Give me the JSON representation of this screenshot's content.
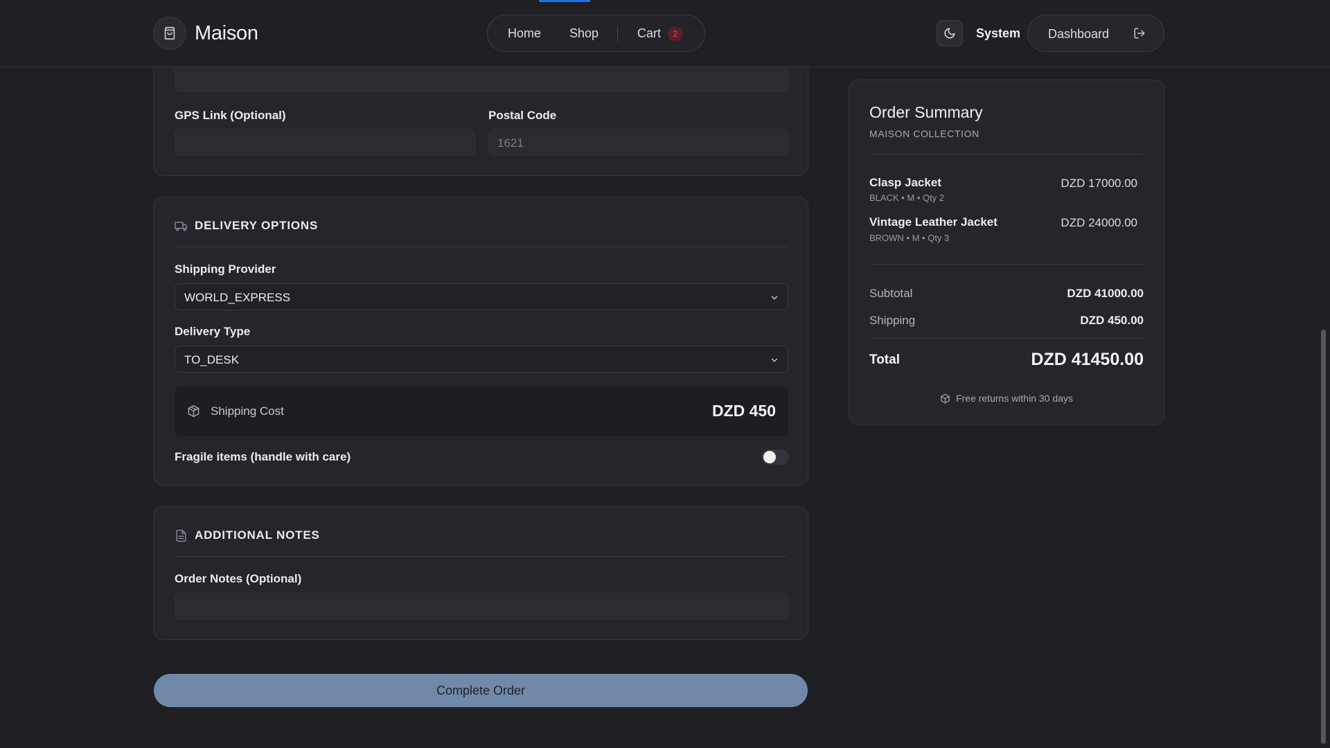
{
  "header": {
    "brand_name": "Maison",
    "nav": {
      "home": "Home",
      "shop": "Shop",
      "cart": "Cart",
      "cart_count": "2"
    },
    "theme_label": "System",
    "dashboard_label": "Dashboard"
  },
  "address": {
    "gps_label": "GPS Link (Optional)",
    "gps_value": "",
    "postal_label": "Postal Code",
    "postal_placeholder": "1621"
  },
  "delivery": {
    "title": "DELIVERY OPTIONS",
    "provider_label": "Shipping Provider",
    "provider_value": "WORLD_EXPRESS",
    "type_label": "Delivery Type",
    "type_value": "TO_DESK",
    "shipping_cost_label": "Shipping Cost",
    "shipping_cost_value": "DZD 450",
    "fragile_label": "Fragile items (handle with care)",
    "fragile_on": false
  },
  "notes": {
    "title": "ADDITIONAL NOTES",
    "label": "Order Notes (Optional)",
    "value": ""
  },
  "complete_button": "Complete Order",
  "summary": {
    "title": "Order Summary",
    "subtitle": "MAISON COLLECTION",
    "items": [
      {
        "name": "Clasp Jacket",
        "meta": "BLACK • M • Qty 2",
        "price": "DZD 17000.00"
      },
      {
        "name": "Vintage Leather Jacket",
        "meta": "BROWN • M • Qty 3",
        "price": "DZD 24000.00"
      }
    ],
    "subtotal_label": "Subtotal",
    "subtotal_value": "DZD 41000.00",
    "shipping_label": "Shipping",
    "shipping_value": "DZD 450.00",
    "total_label": "Total",
    "total_value": "DZD 41450.00",
    "returns_note": "Free returns within 30 days"
  },
  "colors": {
    "background": "#1f1f24",
    "card": "#25252b",
    "accent_button": "#7089a8",
    "cart_badge": "#5a1e26",
    "active_indicator": "#1a73e8"
  },
  "icons": [
    "shopping-bag-icon",
    "moon-icon",
    "logout-icon",
    "truck-icon",
    "chevron-down-icon",
    "package-icon",
    "file-text-icon"
  ]
}
